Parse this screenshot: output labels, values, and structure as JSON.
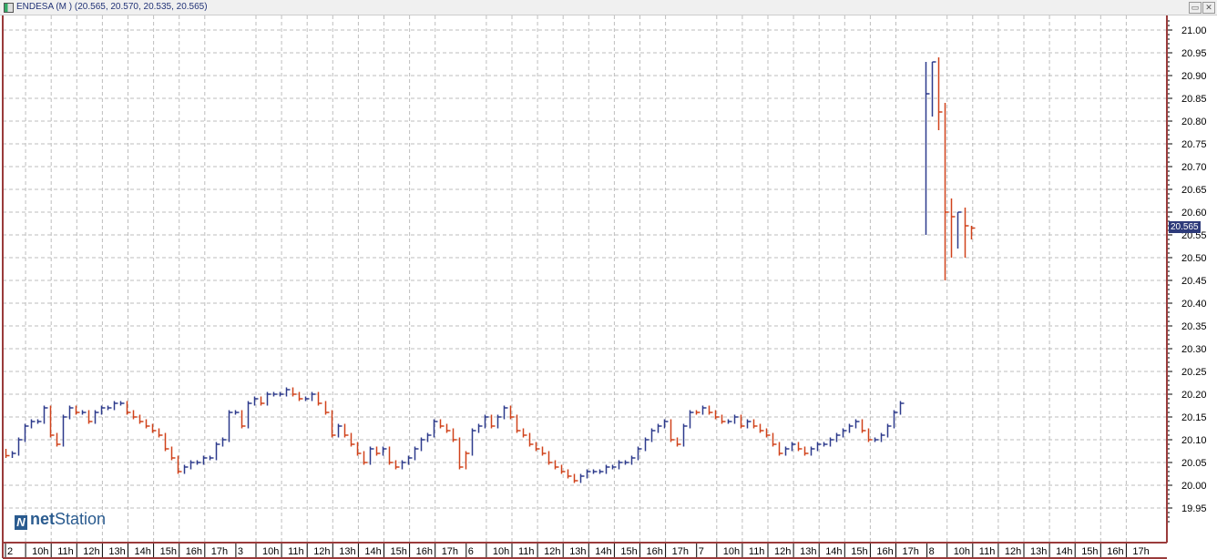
{
  "window": {
    "title": "ENDESA (M ) (20.565, 20.570, 20.535, 20.565)",
    "restore_icon": "restore-icon",
    "close_icon": "close-icon"
  },
  "logo": {
    "mark": "N",
    "bold": "net",
    "rest": "Station"
  },
  "last_price": "20.565",
  "colors": {
    "up": "#2d3a8c",
    "down": "#d0421b",
    "border": "#9a3b3b",
    "grid": "#bdbdbd",
    "label_bg": "#2d3a7a"
  },
  "chart_data": {
    "type": "ohlc",
    "title": "ENDESA (M )",
    "ylim": [
      19.92,
      21.03
    ],
    "y_ticks": [
      "21.00",
      "20.95",
      "20.90",
      "20.85",
      "20.80",
      "20.75",
      "20.70",
      "20.65",
      "20.60",
      "20.55",
      "20.50",
      "20.45",
      "20.40",
      "20.35",
      "20.30",
      "20.25",
      "20.20",
      "20.15",
      "20.10",
      "20.05",
      "20.00",
      "19.95"
    ],
    "x_labels": [
      "2",
      "10h",
      "11h",
      "12h",
      "13h",
      "14h",
      "15h",
      "16h",
      "17h",
      "3",
      "10h",
      "11h",
      "12h",
      "13h",
      "14h",
      "15h",
      "16h",
      "17h",
      "6",
      "10h",
      "11h",
      "12h",
      "13h",
      "14h",
      "15h",
      "16h",
      "17h",
      "7",
      "10h",
      "11h",
      "12h",
      "13h",
      "14h",
      "15h",
      "16h",
      "17h",
      "8",
      "10h",
      "11h",
      "12h",
      "13h",
      "14h",
      "15h",
      "16h",
      "17h"
    ],
    "bars_per_day": 36,
    "days": [
      {
        "label": "2",
        "closes": [
          20.065,
          20.07,
          20.1,
          20.13,
          20.14,
          20.14,
          20.17,
          20.11,
          20.09,
          20.15,
          20.17,
          20.16,
          20.16,
          20.14,
          20.16,
          20.17,
          20.17,
          20.18,
          20.18,
          20.16,
          20.15,
          20.14,
          20.13,
          20.12,
          20.11,
          20.08,
          20.06,
          20.03,
          20.04,
          20.05,
          20.05,
          20.06,
          20.06,
          20.09,
          20.1,
          20.16
        ]
      },
      {
        "label": "3",
        "closes": [
          20.16,
          20.13,
          20.18,
          20.19,
          20.18,
          20.2,
          20.2,
          20.2,
          20.21,
          20.2,
          20.19,
          20.19,
          20.2,
          20.18,
          20.16,
          20.11,
          20.13,
          20.11,
          20.09,
          20.07,
          20.05,
          20.08,
          20.07,
          20.08,
          20.05,
          20.04,
          20.05,
          20.06,
          20.08,
          20.1,
          20.11,
          20.14,
          20.13,
          20.12,
          20.1,
          20.04
        ]
      },
      {
        "label": "6",
        "closes": [
          20.07,
          20.12,
          20.13,
          20.15,
          20.13,
          20.15,
          20.17,
          20.15,
          20.12,
          20.11,
          20.09,
          20.08,
          20.07,
          20.05,
          20.04,
          20.03,
          20.02,
          20.01,
          20.02,
          20.03,
          20.03,
          20.03,
          20.04,
          20.04,
          20.05,
          20.05,
          20.06,
          20.08,
          20.1,
          20.12,
          20.13,
          20.14,
          20.1,
          20.09,
          20.13,
          20.16
        ]
      },
      {
        "label": "7",
        "closes": [
          20.16,
          20.17,
          20.16,
          20.15,
          20.14,
          20.14,
          20.15,
          20.13,
          20.14,
          20.13,
          20.12,
          20.11,
          20.09,
          20.07,
          20.08,
          20.09,
          20.08,
          20.07,
          20.08,
          20.09,
          20.09,
          20.1,
          20.11,
          20.12,
          20.13,
          20.14,
          20.12,
          20.1,
          20.1,
          20.11,
          20.13,
          20.16,
          20.18
        ]
      },
      {
        "label": "8",
        "hlc": [
          [
            20.93,
            20.55,
            20.86
          ],
          [
            20.93,
            20.81,
            20.93
          ],
          [
            20.94,
            20.78,
            20.82
          ],
          [
            20.84,
            20.45,
            20.6
          ],
          [
            20.63,
            20.5,
            20.59
          ],
          [
            20.6,
            20.52,
            20.6
          ],
          [
            20.61,
            20.5,
            20.57
          ],
          [
            20.57,
            20.54,
            20.565
          ]
        ]
      }
    ]
  }
}
